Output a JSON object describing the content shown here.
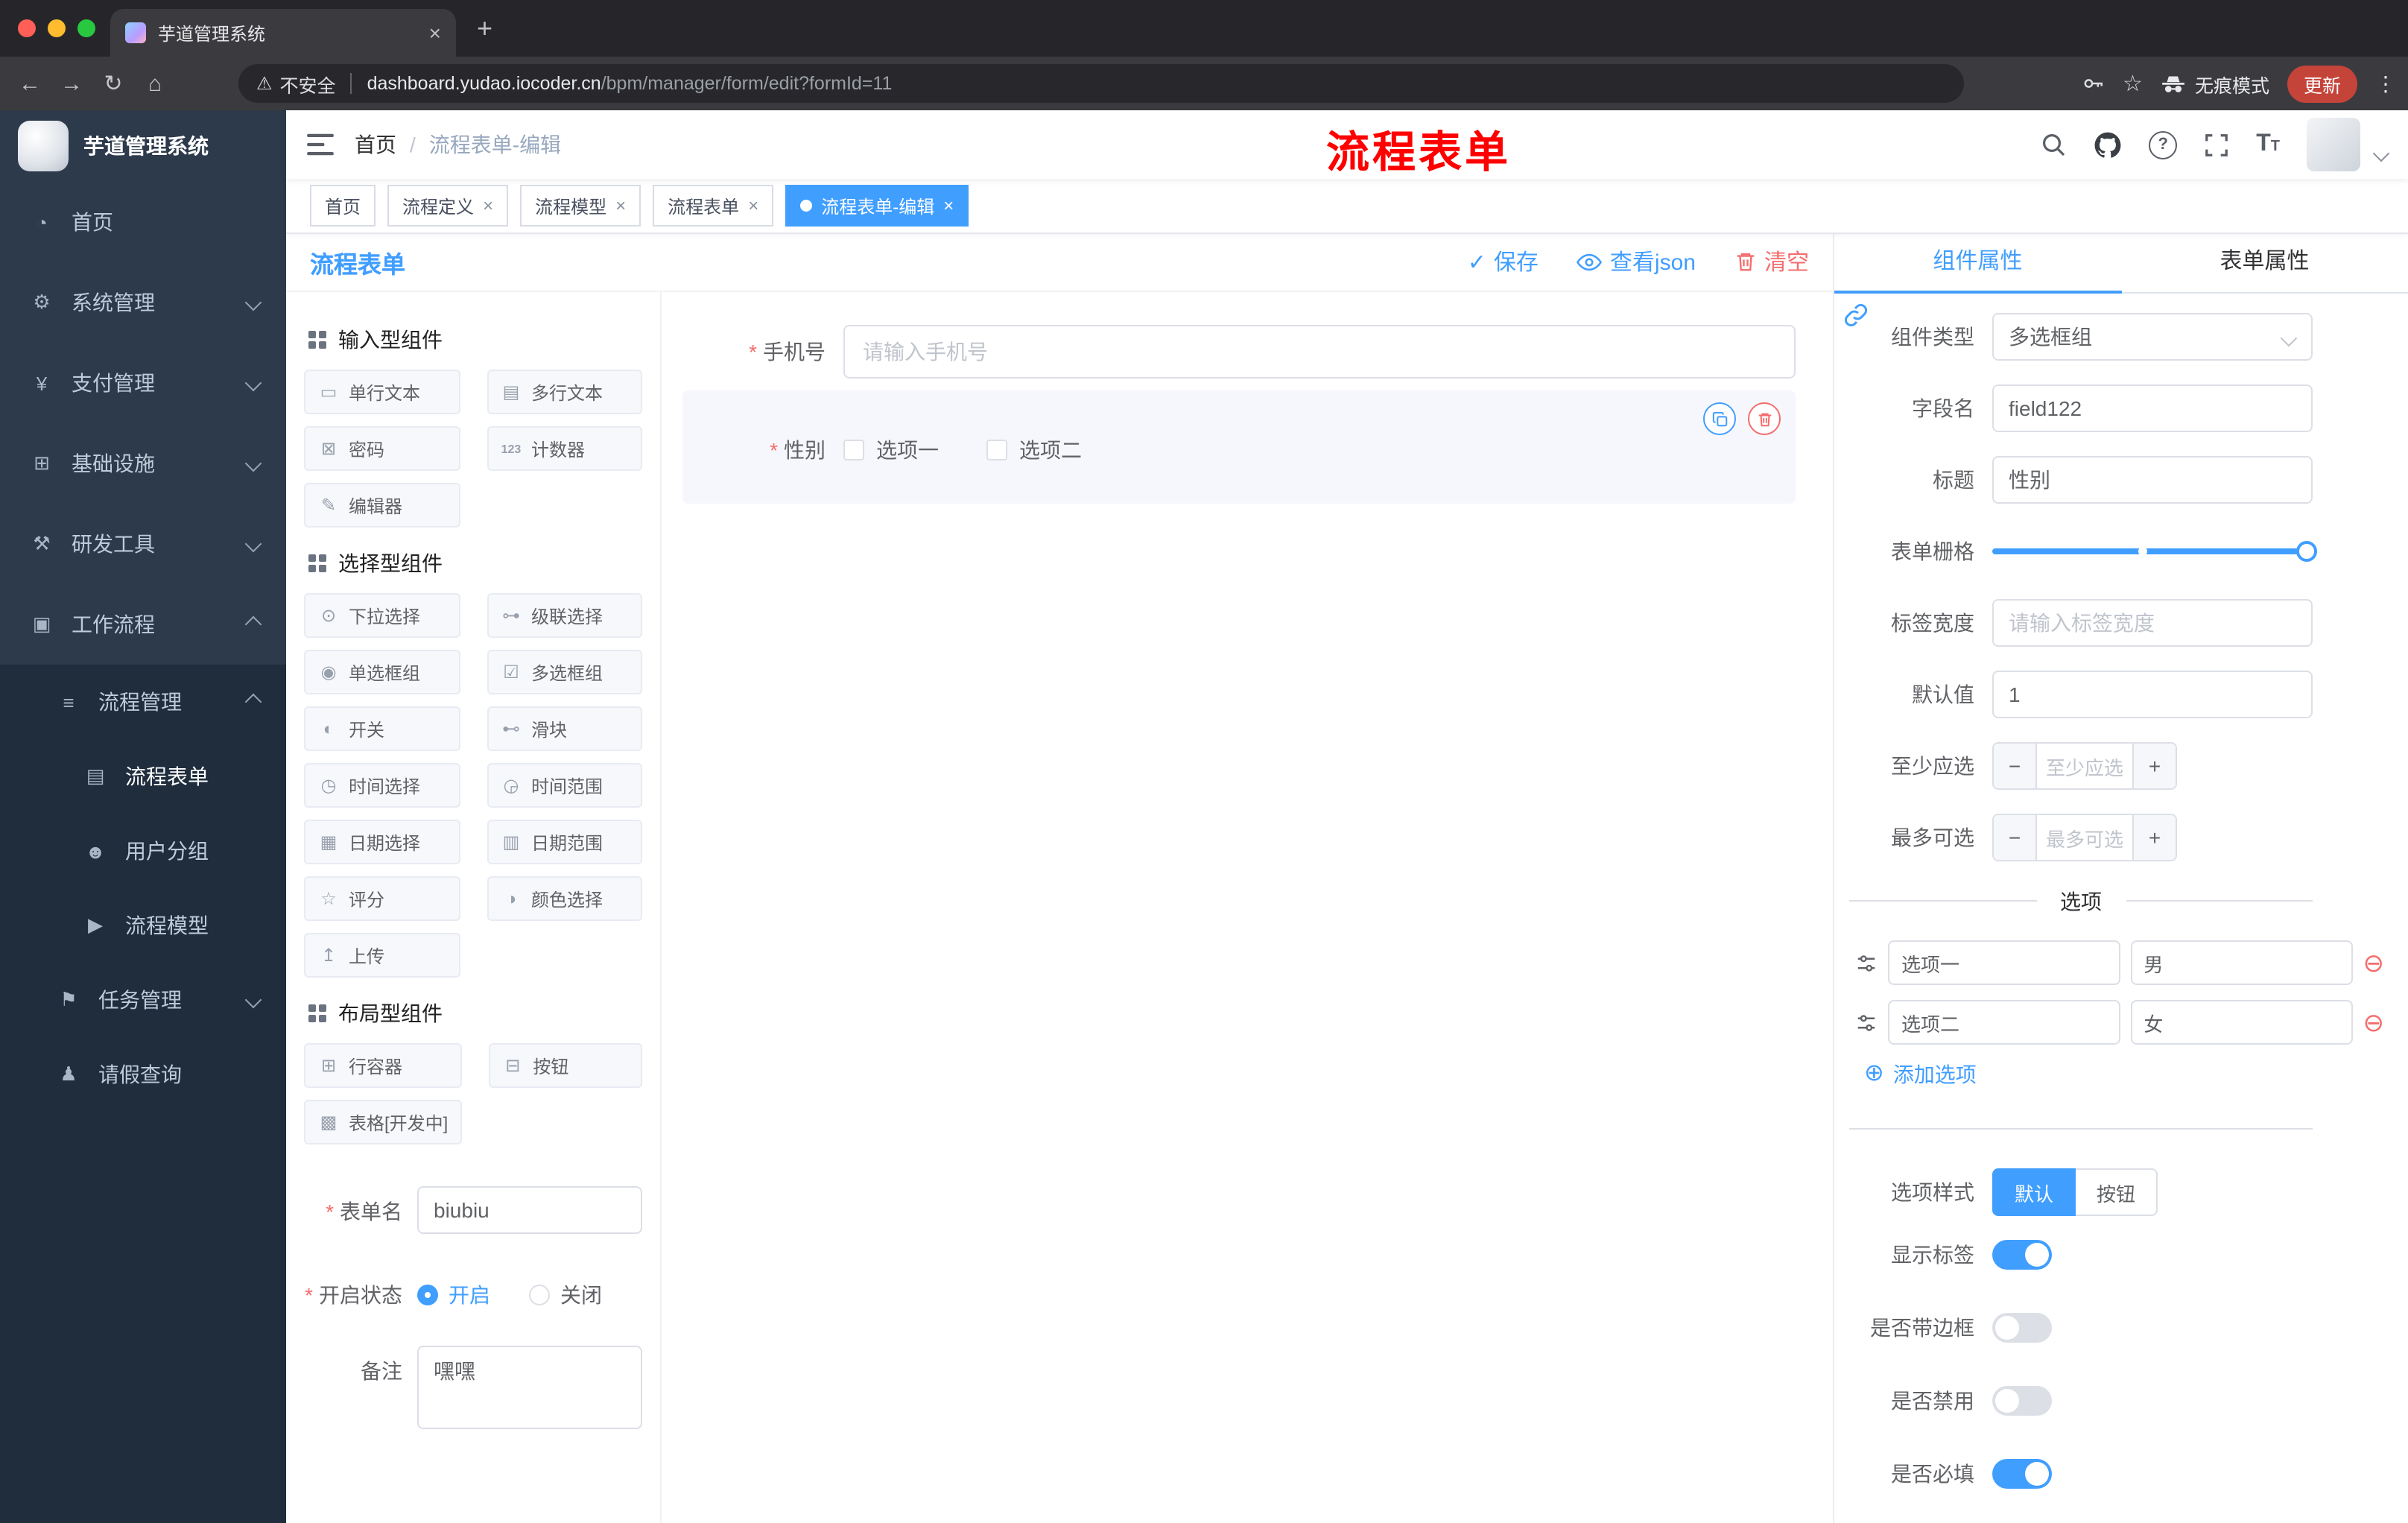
{
  "accent": "#409eff",
  "danger": "#f56c6c",
  "browser": {
    "tab_title": "芋道管理系统",
    "security_label": "不安全",
    "url_host": "dashboard.yudao.iocoder.cn",
    "url_path": "/bpm/manager/form/edit?formId=11",
    "incognito_label": "无痕模式",
    "update_label": "更新"
  },
  "sidebar": {
    "app_title": "芋道管理系统",
    "items": [
      {
        "label": "首页"
      },
      {
        "label": "系统管理"
      },
      {
        "label": "支付管理"
      },
      {
        "label": "基础设施"
      },
      {
        "label": "研发工具"
      },
      {
        "label": "工作流程"
      },
      {
        "label": "流程管理"
      },
      {
        "label": "流程表单"
      },
      {
        "label": "用户分组"
      },
      {
        "label": "流程模型"
      },
      {
        "label": "任务管理"
      },
      {
        "label": "请假查询"
      }
    ]
  },
  "navbar": {
    "breadcrumb_home": "首页",
    "breadcrumb_sep": "/",
    "breadcrumb_current": "流程表单-编辑",
    "annotation": "流程表单"
  },
  "tags": [
    {
      "label": "首页"
    },
    {
      "label": "流程定义"
    },
    {
      "label": "流程模型"
    },
    {
      "label": "流程表单"
    },
    {
      "label": "流程表单-编辑"
    }
  ],
  "editor": {
    "title": "流程表单",
    "save": "保存",
    "view_json": "查看json",
    "clear": "清空"
  },
  "palette": {
    "group_input": "输入型组件",
    "group_select": "选择型组件",
    "group_layout": "布局型组件",
    "input_items": [
      "单行文本",
      "多行文本",
      "密码",
      "计数器",
      "编辑器"
    ],
    "select_items": [
      "下拉选择",
      "级联选择",
      "单选框组",
      "多选框组",
      "开关",
      "滑块",
      "时间选择",
      "时间范围",
      "日期选择",
      "日期范围",
      "评分",
      "颜色选择",
      "上传"
    ],
    "layout_items": [
      "行容器",
      "按钮",
      "表格[开发中]"
    ]
  },
  "form_meta": {
    "name_label": "表单名",
    "name_value": "biubiu",
    "status_label": "开启状态",
    "status_on": "开启",
    "status_off": "关闭",
    "remark_label": "备注",
    "remark_value": "嘿嘿"
  },
  "canvas": {
    "phone_label": "手机号",
    "phone_placeholder": "请输入手机号",
    "gender_label": "性别",
    "gender_option1": "选项一",
    "gender_option2": "选项二"
  },
  "props": {
    "tab_component": "组件属性",
    "tab_form": "表单属性",
    "type_label": "组件类型",
    "type_value": "多选框组",
    "field_label": "字段名",
    "field_value": "field122",
    "title_label": "标题",
    "title_value": "性别",
    "grid_label": "表单栅格",
    "labelwidth_label": "标签宽度",
    "labelwidth_placeholder": "请输入标签宽度",
    "default_label": "默认值",
    "default_value": "1",
    "min_label": "至少应选",
    "min_placeholder": "至少应选",
    "max_label": "最多可选",
    "max_placeholder": "最多可选",
    "options_divider": "选项",
    "option1_label": "选项一",
    "option1_value": "男",
    "option2_label": "选项二",
    "option2_value": "女",
    "add_option": "添加选项",
    "style_label": "选项样式",
    "style_default": "默认",
    "style_button": "按钮",
    "toggle_show_label": "显示标签",
    "toggle_border": "是否带边框",
    "toggle_disabled": "是否禁用",
    "toggle_required": "是否必填"
  },
  "icons": {
    "back": "←",
    "forward": "→",
    "reload": "↻",
    "home": "⌂",
    "warning": "⚠",
    "star": "☆",
    "menu_dots": "⋮",
    "close": "×",
    "plus": "+",
    "minus": "−",
    "question": "?",
    "font_size": "T",
    "dashboard": "◔",
    "gear": "⚙",
    "yen": "¥",
    "infra": "⊞",
    "tools": "⚒",
    "workflow": "▣",
    "list": "≡",
    "doc": "▤",
    "users": "☻",
    "send": "▶",
    "flag": "⚑",
    "person": "♟",
    "check": "✓",
    "single_text": "▭",
    "multi_text": "▤",
    "password": "⊠",
    "counter": "123",
    "editor": "✎",
    "select": "⊙",
    "cascader": "⊶",
    "radio": "◉",
    "checkbox": "☑",
    "switch": "◐",
    "slider": "⊷",
    "time": "◷",
    "time_range": "◶",
    "date": "▦",
    "date_range": "▥",
    "rate": "☆",
    "color": "◑",
    "upload": "↥",
    "row": "⊞",
    "button": "⊟",
    "table": "▩",
    "add": "⊕",
    "remove": "⊖"
  }
}
